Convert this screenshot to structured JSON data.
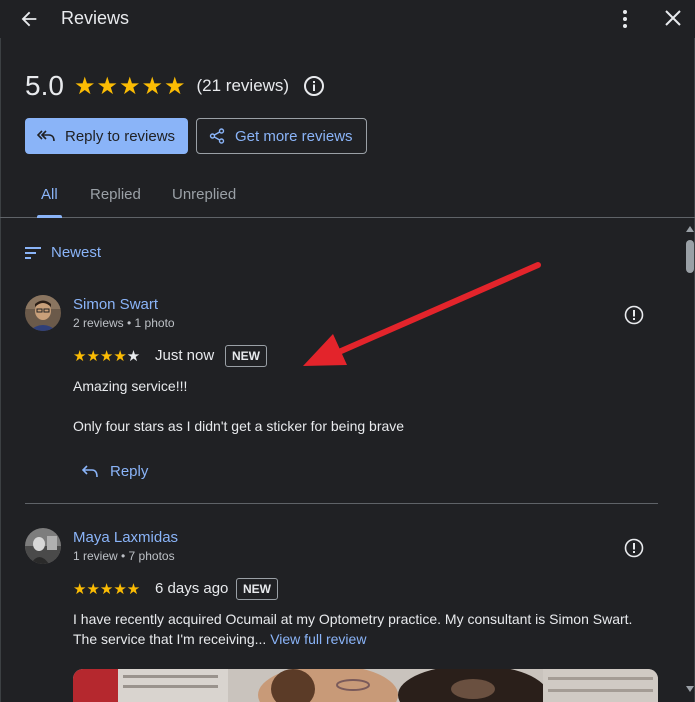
{
  "header": {
    "title": "Reviews"
  },
  "summary": {
    "score": "5.0",
    "stars": "★★★★★",
    "review_count": "(21 reviews)"
  },
  "actions": {
    "reply_label": "Reply to reviews",
    "more_label": "Get more reviews"
  },
  "tabs": [
    {
      "label": "All",
      "active": true
    },
    {
      "label": "Replied",
      "active": false
    },
    {
      "label": "Unreplied",
      "active": false
    }
  ],
  "sort": {
    "label": "Newest"
  },
  "reviews": [
    {
      "name": "Simon Swart",
      "meta": "2 reviews • 1 photo",
      "stars_filled": "★★★★",
      "stars_empty": "★",
      "rating": 4,
      "when": "Just now",
      "badge": "NEW",
      "text_line1": "Amazing service!!!",
      "text_line2": "Only four stars as I didn't get a sticker for being brave",
      "reply_label": "Reply"
    },
    {
      "name": "Maya Laxmidas",
      "meta": "1 review • 7 photos",
      "stars_filled": "★★★★★",
      "rating": 5,
      "when": "6 days ago",
      "badge": "NEW",
      "text_line1": "I have recently acquired Ocumail at my Optometry practice.  My consultant is Simon Swart.",
      "text_line2": "The service that I'm receiving...",
      "view_full": "View full review"
    }
  ],
  "colors": {
    "background": "#202124",
    "accent": "#8ab4f8",
    "star": "#fbbc04",
    "annotation_arrow": "#e3242b"
  }
}
